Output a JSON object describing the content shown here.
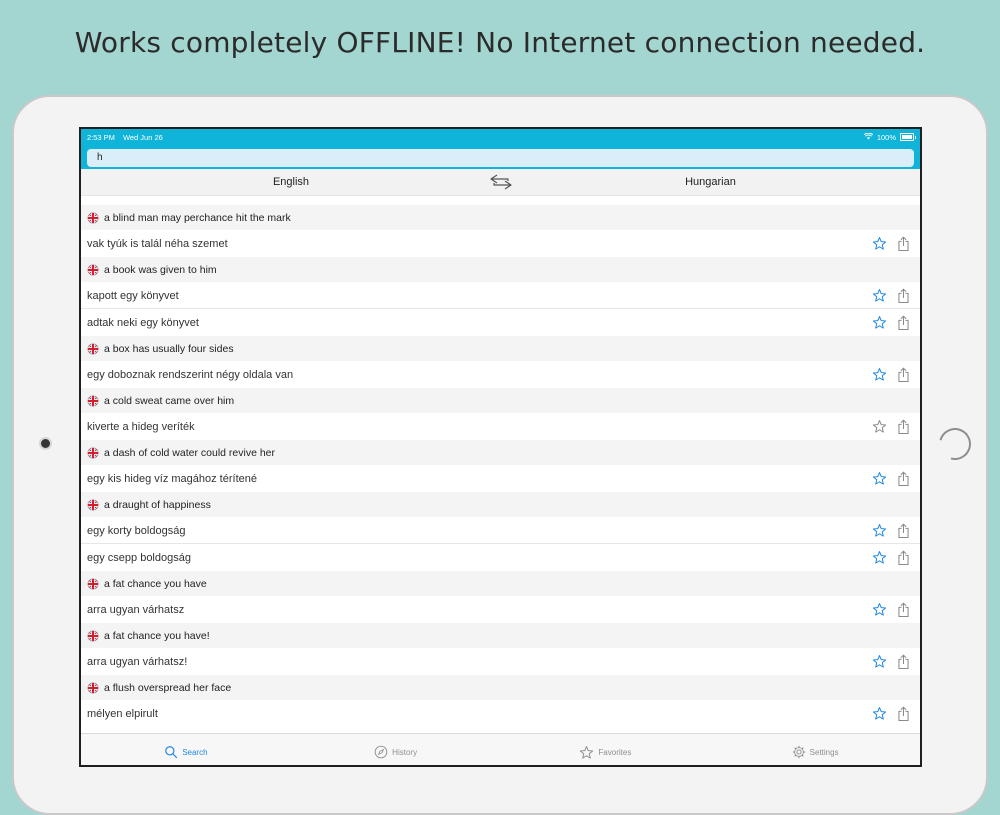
{
  "headline": "Works completely OFFLINE! No Internet connection needed.",
  "colors": {
    "accent": "#10b4d8",
    "star": "#1e88e5",
    "background": "#a3d6d1"
  },
  "status": {
    "time": "2:53 PM",
    "date": "Wed Jun 26",
    "battery": "100%"
  },
  "search": {
    "value": "h"
  },
  "languages": {
    "left": "English",
    "right": "Hungarian",
    "swap_icon": "swap-arrows-icon"
  },
  "entries": [
    {
      "phrase": "a blind man may perchance hit the mark",
      "translations": [
        {
          "text": "vak tyúk is talál néha szemet",
          "favorite": false
        }
      ]
    },
    {
      "phrase": "a book was given to him",
      "translations": [
        {
          "text": "kapott egy könyvet",
          "favorite": false
        },
        {
          "text": "adtak neki egy könyvet",
          "favorite": false
        }
      ]
    },
    {
      "phrase": "a box has usually four sides",
      "translations": [
        {
          "text": "egy doboznak rendszerint négy oldala van",
          "favorite": false
        }
      ]
    },
    {
      "phrase": "a cold sweat came over him",
      "translations": [
        {
          "text": "kiverte a hideg veríték",
          "favorite": false,
          "muted": true
        }
      ]
    },
    {
      "phrase": "a dash of cold water could revive her",
      "translations": [
        {
          "text": "egy kis hideg víz magához térítené",
          "favorite": false
        }
      ]
    },
    {
      "phrase": "a draught of happiness",
      "translations": [
        {
          "text": "egy korty boldogság",
          "favorite": false
        },
        {
          "text": "egy csepp boldogság",
          "favorite": false
        }
      ]
    },
    {
      "phrase": "a fat chance you have",
      "translations": [
        {
          "text": "arra ugyan várhatsz",
          "favorite": false
        }
      ]
    },
    {
      "phrase": "a fat chance you have!",
      "translations": [
        {
          "text": "arra ugyan várhatsz!",
          "favorite": false
        }
      ]
    },
    {
      "phrase": "a flush overspread her face",
      "translations": [
        {
          "text": "mélyen elpirult",
          "favorite": false
        }
      ]
    }
  ],
  "tabs": [
    {
      "label": "Search",
      "icon": "search-icon",
      "active": true
    },
    {
      "label": "History",
      "icon": "compass-icon",
      "active": false
    },
    {
      "label": "Favorites",
      "icon": "star-icon",
      "active": false
    },
    {
      "label": "Settings",
      "icon": "gear-icon",
      "active": false
    }
  ]
}
